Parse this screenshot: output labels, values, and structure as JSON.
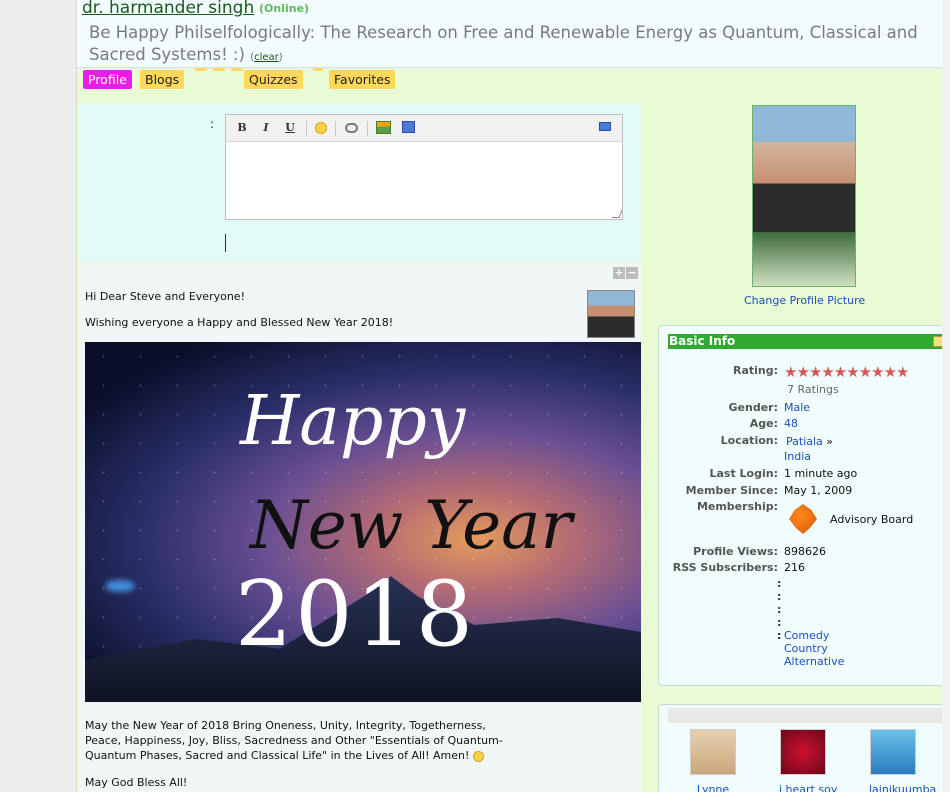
{
  "header": {
    "user_name": "dr. harmander singh",
    "online_status": "(Online)",
    "status_message": "Be Happy Philselfologically: The Research on Free and Renewable Energy as Quantum, Classical and Sacred Systems! :)",
    "clear_label": "clear"
  },
  "nav": {
    "tabs": [
      {
        "label": "Profile",
        "active": true
      },
      {
        "label": "Blogs"
      },
      {
        "label": "Quizzes"
      },
      {
        "label": "Favorites"
      }
    ]
  },
  "comment_editor": {
    "colon": ":",
    "toolbar": {
      "bold": "B",
      "italic": "I",
      "underline": "U"
    }
  },
  "post": {
    "greeting": "Hi Dear Steve and Everyone!",
    "wish": "Wishing everyone a Happy and Blessed New Year 2018!",
    "image_text": {
      "happy": "Happy",
      "new_year": "New Year",
      "year": "2018"
    },
    "body": "May the New Year of 2018 Bring Oneness, Unity, Integrity, Togetherness, Peace, Happiness, Joy, Bliss, Sacredness and Other \"Essentials of Quantum-Quantum Phases, Sacred and Classical Life\" in the Lives of All! Amen!",
    "closing": "May God Bless All!",
    "controls": {
      "plus": "+",
      "minus": "−"
    }
  },
  "profile": {
    "change_picture": "Change Profile Picture"
  },
  "basic_info": {
    "title": "Basic Info",
    "rating_label": "Rating:",
    "rating_stars": 10,
    "ratings_count": "7 Ratings",
    "gender_label": "Gender:",
    "gender": "Male",
    "age_label": "Age:",
    "age": "48",
    "location_label": "Location:",
    "location_city": "Patiala",
    "location_sep": "»",
    "location_country": "India",
    "last_login_label": "Last Login:",
    "last_login": "1 minute ago",
    "member_since_label": "Member Since:",
    "member_since": "May 1, 2009",
    "membership_label": "Membership:",
    "membership": "Advisory Board",
    "profile_views_label": "Profile Views:",
    "profile_views": "898626",
    "rss_label": "RSS Subscribers:",
    "rss": "216",
    "genres": [
      "Comedy",
      "Country",
      "Alternative"
    ]
  },
  "friends": [
    {
      "name": "Lynne"
    },
    {
      "name": "i heart soy"
    },
    {
      "name": "lainikuumba"
    }
  ],
  "colors": {
    "accent_green": "#2fa92f",
    "tab_yellow": "#ffd75a",
    "tab_active": "#e81de8",
    "link_blue": "#1a4fbf"
  }
}
